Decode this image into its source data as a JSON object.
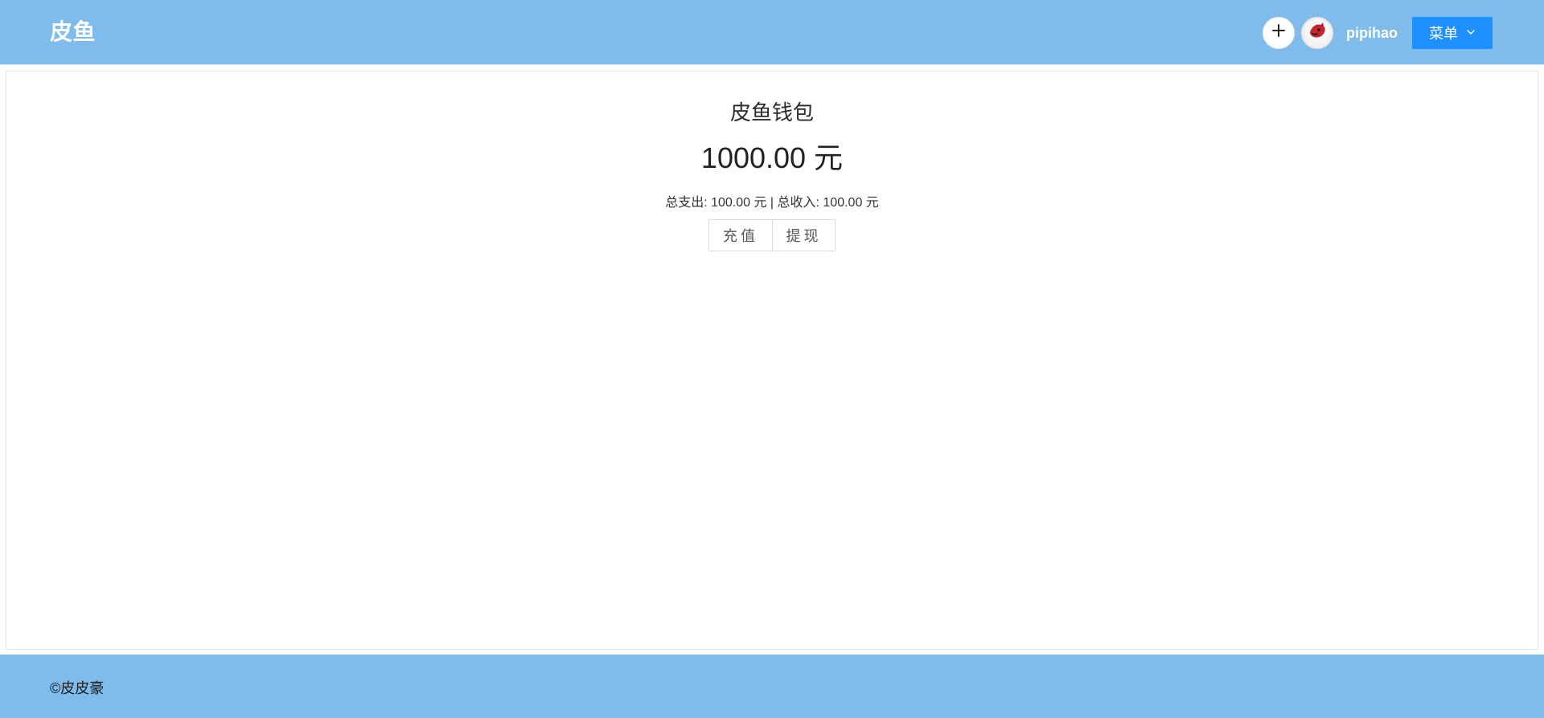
{
  "header": {
    "brand": "皮鱼",
    "username": "pipihao",
    "menu_label": "菜单",
    "icons": {
      "add": "plus-icon",
      "avatar": "avatar-icon",
      "menu_chevron": "chevron-down-icon"
    },
    "colors": {
      "bar": "#7fbbeb",
      "menu_button": "#1e90ff"
    }
  },
  "wallet": {
    "title": "皮鱼钱包",
    "balance": "1000.00 元",
    "stats_text": "总支出: 100.00 元 | 总收入: 100.00 元",
    "recharge_label": "充值",
    "withdraw_label": "提现"
  },
  "footer": {
    "text": "©皮皮豪"
  }
}
